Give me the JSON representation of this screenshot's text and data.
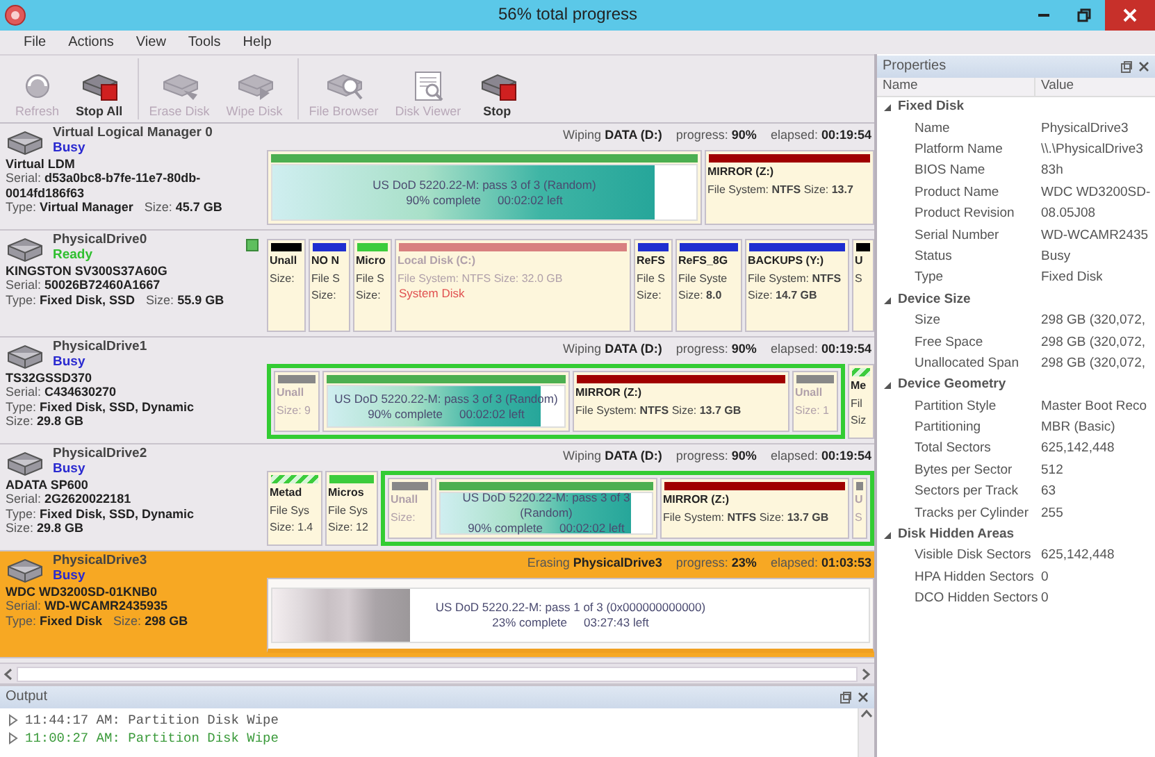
{
  "window": {
    "title": "56% total progress"
  },
  "menu": [
    "File",
    "Actions",
    "View",
    "Tools",
    "Help"
  ],
  "toolbar": [
    [
      {
        "label": "Refresh",
        "kind": "refresh",
        "disabled": true
      },
      {
        "label": "Stop All",
        "kind": "stop",
        "disabled": false
      }
    ],
    [
      {
        "label": "Erase Disk",
        "kind": "erase",
        "disabled": true
      },
      {
        "label": "Wipe Disk",
        "kind": "wipe",
        "disabled": true
      }
    ],
    [
      {
        "label": "File Browser",
        "kind": "browse",
        "disabled": true
      },
      {
        "label": "Disk Viewer",
        "kind": "viewer",
        "disabled": true
      },
      {
        "label": "Stop",
        "kind": "stop",
        "disabled": false
      }
    ]
  ],
  "disks": [
    {
      "name": "Virtual Logical Manager 0",
      "status": "Busy",
      "color": "#2a2ad0",
      "selected": false,
      "indicator": false,
      "model": "Virtual LDM",
      "details": [
        [
          {
            "label": "Serial:",
            "value": "d53a0bc8-b7fe-11e7-80db-0014fd186f63"
          }
        ],
        [
          {
            "label": "Type:",
            "value": "Virtual Manager"
          },
          {
            "label": "Size:",
            "value": "45.7 GB"
          }
        ]
      ],
      "activity": {
        "action": "Wiping **DATA (D:)**",
        "progress": "progress: **90%**",
        "elapsed": "elapsed: **00:19:54**"
      },
      "partitions": [
        {
          "kind": "wipe",
          "color": "#4caf50",
          "level": 0.9,
          "lines": [
            "US DoD 5220.22-M: pass 3 of 3 (Random)"
          ],
          "complete": "90% complete",
          "remaining": "00:02:02 left"
        },
        {
          "kind": "volume",
          "color": "#a00000",
          "dimmed": false,
          "striped": false,
          "lines": [
            "MIRROR (Z:)",
            "File System: **NTFS** Size: **13.7**"
          ]
        }
      ]
    },
    {
      "name": "PhysicalDrive0",
      "status": "Ready",
      "color": "#2fbf2f",
      "selected": false,
      "indicator": true,
      "model": "KINGSTON SV300S37A60G",
      "details": [
        [
          {
            "label": "Serial:",
            "value": "50026B72460A1667"
          }
        ],
        [
          {
            "label": "Type:",
            "value": "Fixed Disk, SSD"
          },
          {
            "label": "Size:",
            "value": "55.9 GB"
          }
        ]
      ],
      "partitions": [
        {
          "kind": "volume",
          "color": "#000000",
          "dimmed": false,
          "striped": false,
          "lines": [
            "Unall",
            "Size:"
          ]
        },
        {
          "kind": "volume",
          "color": "#1f2fd0",
          "dimmed": false,
          "striped": false,
          "lines": [
            "NO N",
            "File S",
            "Size:"
          ]
        },
        {
          "kind": "volume",
          "color": "#3ccc3c",
          "dimmed": false,
          "striped": false,
          "lines": [
            "Micro",
            "File S",
            "Size:"
          ]
        },
        {
          "kind": "volume",
          "color": "#d88080",
          "dimmed": true,
          "striped": false,
          "lines": [
            "Local Disk (C:)",
            "File System: NTFS Size: 32.0 GB"
          ],
          "note": "System Disk"
        },
        {
          "kind": "volume",
          "color": "#1f2fd0",
          "dimmed": false,
          "striped": false,
          "lines": [
            "ReFS",
            "File S",
            "Size:"
          ]
        },
        {
          "kind": "volume",
          "color": "#1f2fd0",
          "dimmed": false,
          "striped": false,
          "lines": [
            "ReFS_8G",
            "File Syste",
            "Size: **8.0**"
          ]
        },
        {
          "kind": "volume",
          "color": "#1f2fd0",
          "dimmed": false,
          "striped": false,
          "lines": [
            "BACKUPS (Y:)",
            "File System: **NTFS**",
            "Size: **14.7 GB**"
          ]
        },
        {
          "kind": "volume",
          "color": "#000000",
          "dimmed": false,
          "striped": false,
          "lines": [
            "U",
            "S"
          ]
        }
      ]
    },
    {
      "name": "PhysicalDrive1",
      "status": "Busy",
      "color": "#2a2ad0",
      "selected": false,
      "indicator": false,
      "model": "TS32GSSD370",
      "details": [
        [
          {
            "label": "Serial:",
            "value": "C434630270"
          }
        ],
        [
          {
            "label": "Type:",
            "value": "Fixed Disk, SSD, Dynamic"
          }
        ],
        [
          {
            "label": "Size:",
            "value": "29.8 GB"
          }
        ]
      ],
      "activity": {
        "action": "Wiping **DATA (D:)**",
        "progress": "progress: **90%**",
        "elapsed": "elapsed: **00:19:54**"
      },
      "partitions": [
        {
          "kind": "group",
          "color": "#33cc33",
          "partitions": [
            {
              "kind": "volume",
              "color": "#888888",
              "dimmed": true,
              "striped": false,
              "lines": [
                "Unall",
                "Size: 9"
              ]
            },
            {
              "kind": "wipe",
              "color": "#4caf50",
              "level": 0.9,
              "lines": [
                "US DoD 5220.22-M: pass 3 of 3 (Random)"
              ],
              "complete": "90% complete",
              "remaining": "00:02:02 left"
            },
            {
              "kind": "volume",
              "color": "#a00000",
              "dimmed": false,
              "striped": false,
              "lines": [
                "MIRROR (Z:)",
                "File System: **NTFS** Size: **13.7 GB**"
              ]
            },
            {
              "kind": "volume",
              "color": "#888888",
              "dimmed": true,
              "striped": false,
              "lines": [
                "Unall",
                "Size: 1"
              ]
            }
          ]
        },
        {
          "kind": "volume",
          "color": "#3ccc3c",
          "dimmed": false,
          "striped": true,
          "lines": [
            "Me",
            "Fil",
            "Siz"
          ]
        }
      ]
    },
    {
      "name": "PhysicalDrive2",
      "status": "Busy",
      "color": "#2a2ad0",
      "selected": false,
      "indicator": false,
      "model": "ADATA SP600",
      "details": [
        [
          {
            "label": "Serial:",
            "value": "2G2620022181"
          }
        ],
        [
          {
            "label": "Type:",
            "value": "Fixed Disk, SSD, Dynamic"
          }
        ],
        [
          {
            "label": "Size:",
            "value": "29.8 GB"
          }
        ]
      ],
      "activity": {
        "action": "Wiping **DATA (D:)**",
        "progress": "progress: **90%**",
        "elapsed": "elapsed: **00:19:54**"
      },
      "partitions": [
        {
          "kind": "volume",
          "color": "#3ccc3c",
          "dimmed": false,
          "striped": true,
          "lines": [
            "Metad",
            "File Sys",
            "Size: 1.4"
          ]
        },
        {
          "kind": "volume",
          "color": "#3ccc3c",
          "dimmed": false,
          "striped": false,
          "lines": [
            "Micros",
            "File Sys",
            "Size: 12"
          ]
        },
        {
          "kind": "group",
          "color": "#33cc33",
          "partitions": [
            {
              "kind": "volume",
              "color": "#888888",
              "dimmed": true,
              "striped": false,
              "lines": [
                "Unall",
                "Size:"
              ]
            },
            {
              "kind": "wipe",
              "color": "#4caf50",
              "level": 0.9,
              "lines": [
                "US DoD 5220.22-M: pass 3 of 3 (Random)"
              ],
              "complete": "90% complete",
              "remaining": "00:02:02 left"
            },
            {
              "kind": "volume",
              "color": "#a00000",
              "dimmed": false,
              "striped": false,
              "lines": [
                "MIRROR (Z:)",
                "File System: **NTFS** Size: **13.7 GB**"
              ]
            },
            {
              "kind": "volume",
              "color": "#888888",
              "dimmed": true,
              "striped": false,
              "lines": [
                "U",
                "S"
              ]
            }
          ]
        }
      ]
    },
    {
      "name": "PhysicalDrive3",
      "status": "Busy",
      "color": "#2a2ad0",
      "selected": true,
      "indicator": false,
      "model": "WDC WD3200SD-01KNB0",
      "details": [
        [
          {
            "label": "Serial:",
            "value": "WD-WCAMR2435935"
          }
        ],
        [
          {
            "label": "Type:",
            "value": "Fixed Disk"
          },
          {
            "label": "Size:",
            "value": "298 GB"
          }
        ]
      ],
      "activity": {
        "action": "Erasing **PhysicalDrive3**",
        "progress": "progress: **23%**",
        "elapsed": "elapsed: **01:03:53**"
      },
      "partitions": [
        {
          "kind": "erase",
          "color": "#f0a020",
          "level": 0.23,
          "lines": [
            "US DoD 5220.22-M: pass 1 of 3 (0x000000000000)"
          ],
          "complete": "23% complete",
          "remaining": "03:27:43 left"
        }
      ]
    }
  ],
  "output": {
    "title": "Output",
    "lines": [
      {
        "text": "11:44:17 AM: Partition Disk Wipe",
        "kind": "info"
      },
      {
        "text": "11:00:27 AM: Partition Disk Wipe",
        "kind": "success"
      }
    ]
  },
  "properties": {
    "title": "Properties",
    "columns": [
      "Name",
      "Value"
    ],
    "groups": [
      {
        "title": "Fixed Disk",
        "expanded": true,
        "rows": [
          {
            "name": "Name",
            "value": "PhysicalDrive3"
          },
          {
            "name": "Platform Name",
            "value": "\\\\.\\PhysicalDrive3"
          },
          {
            "name": "BIOS Name",
            "value": "83h"
          },
          {
            "name": "Product Name",
            "value": "WDC WD3200SD-"
          },
          {
            "name": "Product Revision",
            "value": "08.05J08"
          },
          {
            "name": "Serial Number",
            "value": "WD-WCAMR2435"
          },
          {
            "name": "Status",
            "value": "Busy"
          },
          {
            "name": "Type",
            "value": "Fixed Disk"
          }
        ]
      },
      {
        "title": "Device Size",
        "expanded": true,
        "rows": [
          {
            "name": "Size",
            "value": "298 GB (320,072,"
          },
          {
            "name": "Free Space",
            "value": "298 GB (320,072,"
          },
          {
            "name": "Unallocated Span",
            "value": "298 GB (320,072,"
          }
        ]
      },
      {
        "title": "Device Geometry",
        "expanded": true,
        "rows": [
          {
            "name": "Partition Style",
            "value": "Master Boot Reco"
          },
          {
            "name": "Partitioning",
            "value": "MBR (Basic)"
          },
          {
            "name": "Total Sectors",
            "value": "625,142,448"
          },
          {
            "name": "Bytes per Sector",
            "value": "512"
          },
          {
            "name": "Sectors per Track",
            "value": "63"
          },
          {
            "name": "Tracks per Cylinder",
            "value": "255"
          }
        ]
      },
      {
        "title": "Disk Hidden Areas",
        "expanded": true,
        "rows": [
          {
            "name": "Visible Disk Sectors",
            "value": "625,142,448"
          },
          {
            "name": "HPA Hidden Sectors",
            "value": "0"
          },
          {
            "name": "DCO Hidden Sectors",
            "value": "0"
          }
        ]
      }
    ]
  }
}
